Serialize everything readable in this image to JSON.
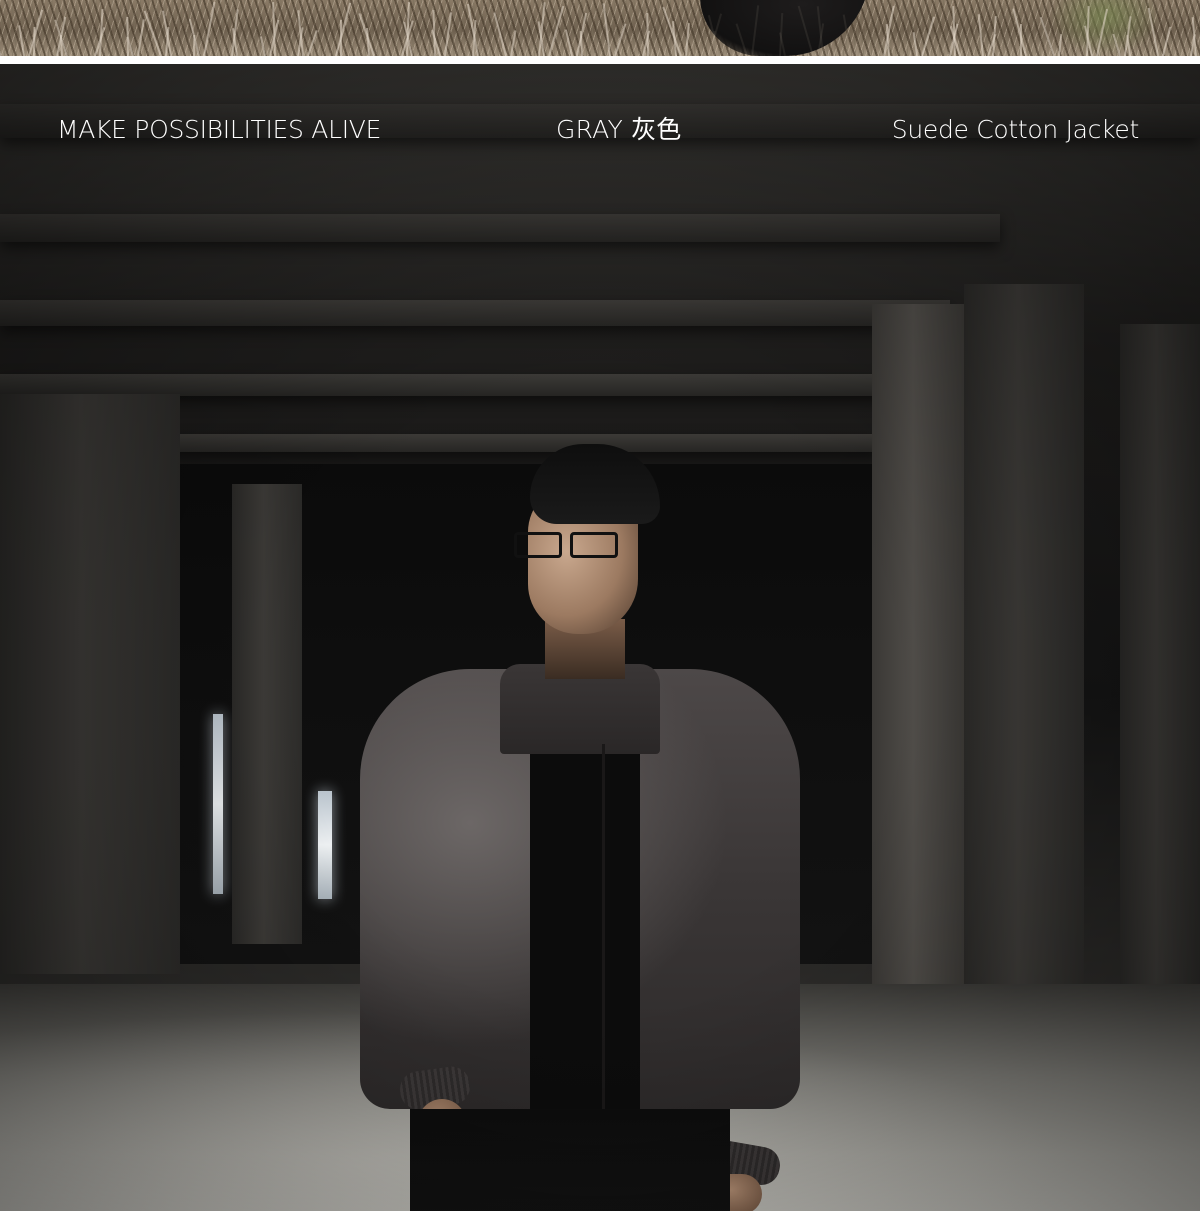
{
  "top_photo": {
    "scene": "outdoor dried grass"
  },
  "main_photo": {
    "scene": "concrete interior with model in jacket"
  },
  "overlay": {
    "tagline": "MAKE POSSIBILITIES ALIVE",
    "color": "GRAY 灰色",
    "product_name": "Suede Cotton Jacket"
  },
  "colors": {
    "text": "#ffffff",
    "background": "#ffffff",
    "jacket": "#4d4848"
  }
}
